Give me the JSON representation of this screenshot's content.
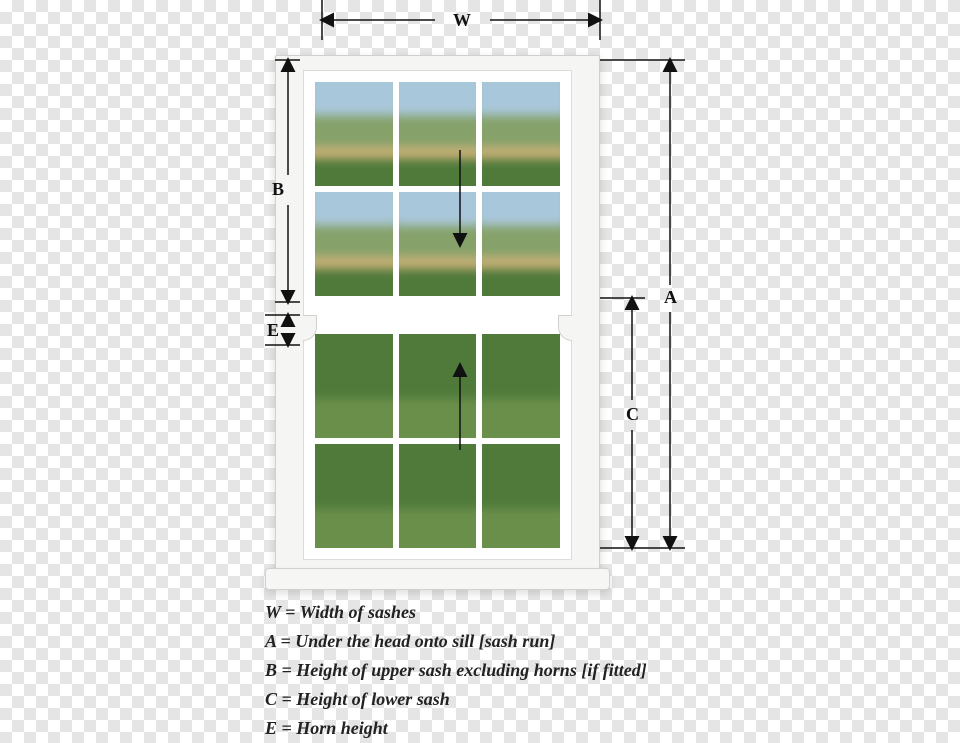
{
  "dim_labels": {
    "W": "W",
    "A": "A",
    "B": "B",
    "C": "C",
    "E": "E"
  },
  "legend": {
    "W": "W = Width of sashes",
    "A": "A = Under the head onto sill [sash run]",
    "B": "B = Height of upper sash excluding horns [if fitted]",
    "C": "C = Height of lower sash",
    "E": "E = Horn height"
  }
}
